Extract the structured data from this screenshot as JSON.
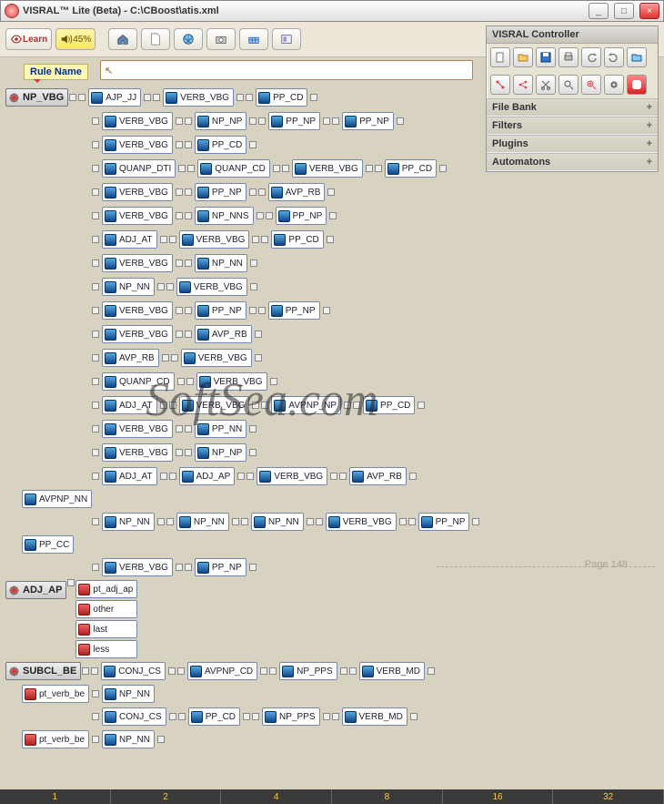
{
  "window": {
    "title": "VISRAL™ Lite (Beta) - C:\\CBoost\\atis.xml",
    "min": "_",
    "max": "□",
    "close": "×"
  },
  "toolbar": {
    "learn": "Learn",
    "volume": "45%"
  },
  "controller": {
    "title": "VISRAL Controller",
    "sections": [
      "File Bank",
      "Filters",
      "Plugins",
      "Automatons"
    ],
    "plus": "+"
  },
  "tooltip": "Rule Name",
  "ruler": [
    "1",
    "2",
    "4",
    "8",
    "16",
    "32"
  ],
  "page_label": "Page 148",
  "watermark": "SoftSea.com",
  "rules": {
    "np_vbg": {
      "head": "NP_VBG",
      "rows": [
        [
          "AJP_JJ",
          "VERB_VBG",
          "PP_CD"
        ],
        [
          "VERB_VBG",
          "NP_NP",
          "PP_NP",
          "PP_NP"
        ],
        [
          "VERB_VBG",
          "PP_CD"
        ],
        [
          "QUANP_DTI",
          "QUANP_CD",
          "VERB_VBG",
          "PP_CD"
        ],
        [
          "VERB_VBG",
          "PP_NP",
          "AVP_RB"
        ],
        [
          "VERB_VBG",
          "NP_NNS",
          "PP_NP"
        ],
        [
          "ADJ_AT",
          "VERB_VBG",
          "PP_CD"
        ],
        [
          "VERB_VBG",
          "NP_NN"
        ],
        [
          "NP_NN",
          "VERB_VBG"
        ],
        [
          "VERB_VBG",
          "PP_NP",
          "PP_NP"
        ],
        [
          "VERB_VBG",
          "AVP_RB"
        ],
        [
          "AVP_RB",
          "VERB_VBG"
        ],
        [
          "QUANP_CD",
          "VERB_VBG"
        ],
        [
          "ADJ_AT",
          "VERB_VBG",
          "AVPNP_NP",
          "PP_CD"
        ],
        [
          "VERB_VBG",
          "PP_NN"
        ],
        [
          "VERB_VBG",
          "NP_NP"
        ],
        [
          "ADJ_AT",
          "ADJ_AP",
          "VERB_VBG",
          "AVP_RB"
        ]
      ]
    },
    "avpnp_nn": {
      "head": "AVPNP_NN",
      "rows": [
        [
          "NP_NN",
          "NP_NN",
          "NP_NN",
          "VERB_VBG",
          "PP_NP"
        ]
      ]
    },
    "pp_cc": {
      "head": "PP_CC",
      "rows": [
        [
          "VERB_VBG",
          "PP_NP"
        ]
      ]
    },
    "adj_ap": {
      "head": "ADJ_AP",
      "items": [
        "pt_adj_ap",
        "other",
        "last",
        "less"
      ]
    },
    "subcl_be": {
      "head": "SUBCL_BE",
      "row1": [
        "CONJ_CS",
        "AVPNP_CD",
        "NP_PPS",
        "VERB_MD"
      ],
      "sub1": {
        "head": "pt_verb_be",
        "tail": "NP_NN",
        "row": [
          "CONJ_CS",
          "PP_CD",
          "NP_PPS",
          "VERB_MD"
        ]
      },
      "sub2": {
        "head": "pt_verb_be",
        "tail": "NP_NN"
      }
    }
  }
}
